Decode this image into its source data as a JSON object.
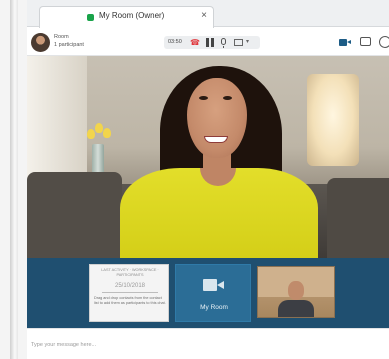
{
  "tab": {
    "title": "My Room (Owner)",
    "close": "×"
  },
  "header": {
    "room_label": "Room",
    "participants": "1 participant",
    "timer": "03:50",
    "hangup": "☎",
    "chevron": "▾"
  },
  "strip": {
    "notes": {
      "heading": "LAST ACTIVITY · WORKSPACE · PARTICIPANTS",
      "date": "25/10/2018",
      "body": "Drag and drop contacts from the contact list to add them as participants to this chat."
    },
    "my_room_label": "My Room"
  },
  "composer": {
    "placeholder": "Type your message here..."
  },
  "colors": {
    "accent": "#1f4f70",
    "tab_dot": "#19a34a",
    "hangup": "#e0393e"
  },
  "icons": [
    "avatar",
    "hangup-icon",
    "pause-icon",
    "mic-icon",
    "screen-share-icon",
    "video-icon",
    "chat-icon",
    "info-icon",
    "camera-icon"
  ]
}
